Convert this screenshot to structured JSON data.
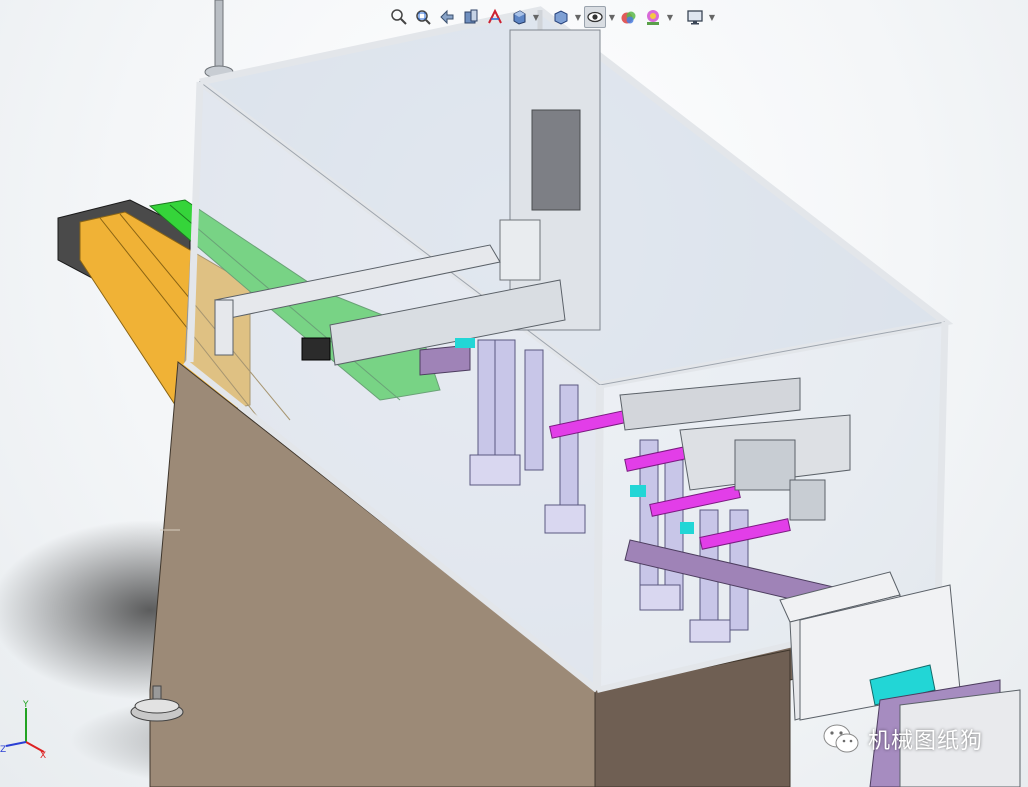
{
  "toolbar": {
    "items": [
      {
        "name": "zoom-to-fit-icon"
      },
      {
        "name": "zoom-to-area-icon"
      },
      {
        "name": "previous-view-icon"
      },
      {
        "name": "section-view-icon"
      },
      {
        "name": "dynamic-annotation-icon"
      },
      {
        "name": "view-orientation-icon"
      },
      {
        "name": "display-style-icon"
      },
      {
        "name": "hide-show-items-icon"
      },
      {
        "name": "edit-appearance-icon"
      },
      {
        "name": "apply-scene-icon"
      },
      {
        "name": "view-settings-icon"
      }
    ]
  },
  "triad": {
    "x_label": "X",
    "y_label": "Y",
    "z_label": "Z"
  },
  "watermark": {
    "text": "机械图纸狗"
  },
  "colors": {
    "cabinet": "#9c8a77",
    "frame": "#c9ced6",
    "glass": "#c9d3e2",
    "conveyor_green": "#35d43a",
    "conveyor_orange": "#f0b236",
    "purple_parts": "#9f83b7",
    "magenta_shafts": "#e23ee8",
    "cyan_parts": "#22d6d6",
    "background": "#f4f6f8"
  }
}
